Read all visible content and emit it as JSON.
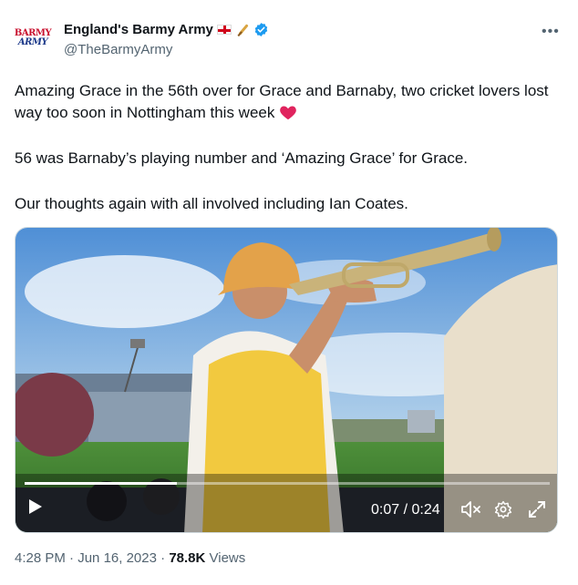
{
  "author": {
    "display_name": "England's Barmy Army",
    "handle": "@TheBarmyArmy",
    "avatar_line1": "BARMY",
    "avatar_line2": "ARMY"
  },
  "tweet": {
    "paragraphs": [
      "Amazing Grace in the 56th over for Grace and Barnaby, two cricket lovers lost way too soon in Nottingham this week",
      "56 was Barnaby’s playing number and ‘Amazing Grace’ for Grace.",
      "Our thoughts again with all involved including Ian Coates."
    ],
    "emoji": "red-heart"
  },
  "video": {
    "time_display": "0:07 / 0:24",
    "progress": 0.29
  },
  "meta": {
    "time": "4:28 PM",
    "separator1": " · ",
    "date": "Jun 16, 2023",
    "separator2": " · ",
    "views_count": "78.8K",
    "views_label": " Views"
  },
  "icons": {
    "flag": "england-flag-icon",
    "bat": "cricket-bat-icon",
    "verified": "verified-badge-icon",
    "more": "more-options-icon"
  },
  "colors": {
    "verified": "#1d9bf0",
    "heart": "#e0245e",
    "handle": "#536471"
  }
}
